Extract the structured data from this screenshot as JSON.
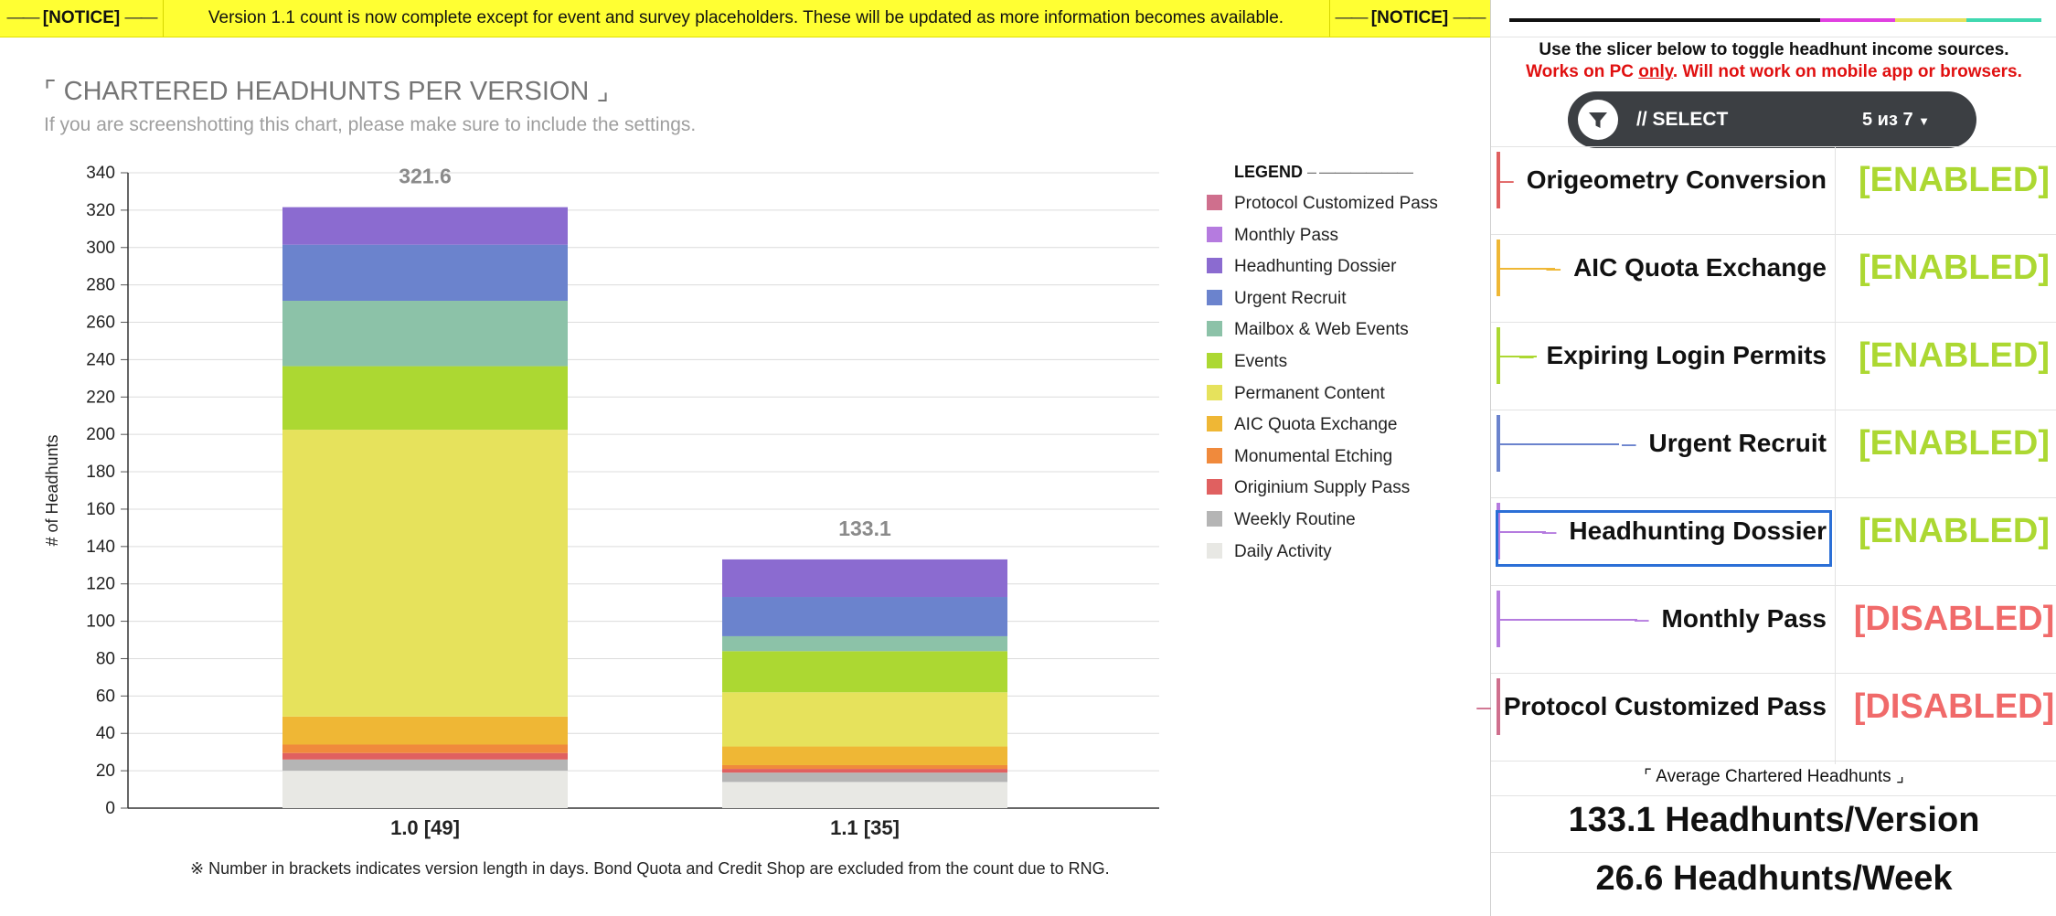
{
  "notice": {
    "tag_left": "[NOTICE]",
    "message": "Version 1.1 count is now complete except for event and survey placeholders. These will be updated as more information becomes available.",
    "tag_right": "[NOTICE]"
  },
  "chart": {
    "title": "CHARTERED HEADHUNTS PER VERSION",
    "title_open": "⌜",
    "title_close": "⌟",
    "subtitle": "If you are screenshotting this chart, please make sure to include the settings.",
    "footnote": "※ Number in brackets indicates version length in days. Bond Quota and Credit Shop are excluded from the count due to RNG.",
    "legend_title": "LEGEND",
    "legend_dash": "– ——————"
  },
  "chart_data": {
    "type": "bar",
    "stacked": true,
    "categories": [
      "1.0 [49]",
      "1.1 [35]"
    ],
    "totals": [
      "321.6",
      "133.1"
    ],
    "ylabel": "# of Headhunts",
    "xlabel": "",
    "ylim": [
      0,
      340
    ],
    "yticks": [
      0,
      20,
      40,
      60,
      80,
      100,
      120,
      140,
      160,
      180,
      200,
      220,
      240,
      260,
      280,
      300,
      320,
      340
    ],
    "grid": true,
    "legend_placement": "right",
    "series": [
      {
        "name": "Daily Activity",
        "color": "#e8e8e4",
        "values": [
          20,
          14
        ]
      },
      {
        "name": "Weekly Routine",
        "color": "#b5b5b5",
        "values": [
          6,
          5
        ]
      },
      {
        "name": "Originium Supply Pass",
        "color": "#e06060",
        "values": [
          3.5,
          2
        ]
      },
      {
        "name": "Monumental Etching",
        "color": "#f08a3c",
        "values": [
          4.5,
          2
        ]
      },
      {
        "name": "AIC Quota Exchange",
        "color": "#efb735",
        "values": [
          15,
          10
        ]
      },
      {
        "name": "Permanent Content",
        "color": "#e6e25c",
        "values": [
          153.5,
          29
        ]
      },
      {
        "name": "Events",
        "color": "#acd832",
        "values": [
          34,
          22
        ]
      },
      {
        "name": "Mailbox & Web Events",
        "color": "#8cc2a8",
        "values": [
          35,
          8
        ]
      },
      {
        "name": "Urgent Recruit",
        "color": "#6b83cd",
        "values": [
          30,
          21
        ]
      },
      {
        "name": "Headhunting Dossier",
        "color": "#8b6bd0",
        "values": [
          20.1,
          20.1
        ]
      },
      {
        "name": "Monthly Pass",
        "color": "#b57bdf",
        "values": [
          0,
          0
        ]
      },
      {
        "name": "Protocol Customized Pass",
        "color": "#cf6f8d",
        "values": [
          0,
          0
        ]
      }
    ]
  },
  "legend": [
    {
      "name": "Protocol Customized Pass",
      "color": "#cf6f8d"
    },
    {
      "name": "Monthly Pass",
      "color": "#b57bdf"
    },
    {
      "name": "Headhunting Dossier",
      "color": "#8b6bd0"
    },
    {
      "name": "Urgent Recruit",
      "color": "#6b83cd"
    },
    {
      "name": "Mailbox & Web Events",
      "color": "#8cc2a8"
    },
    {
      "name": "Events",
      "color": "#acd832"
    },
    {
      "name": "Permanent Content",
      "color": "#e6e25c"
    },
    {
      "name": "AIC Quota Exchange",
      "color": "#efb735"
    },
    {
      "name": "Monumental Etching",
      "color": "#f08a3c"
    },
    {
      "name": "Originium Supply Pass",
      "color": "#e06060"
    },
    {
      "name": "Weekly Routine",
      "color": "#b5b5b5"
    },
    {
      "name": "Daily Activity",
      "color": "#e8e8e4"
    }
  ],
  "panel": {
    "instruction": "Use the slicer below to toggle headhunt income sources.",
    "warning_pre": "Works on PC ",
    "warning_only": "only",
    "warning_post": ". Will not work on mobile app or browsers.",
    "slicer_label": "// SELECT",
    "slicer_count": "5 из 7",
    "strip_colors": [
      "#111111",
      "#e040e0",
      "#e6e25c",
      "#40d8b0"
    ],
    "sources": [
      {
        "name": "Origeometry Conversion",
        "status": "[ENABLED]",
        "color": "#e06060",
        "selected": false
      },
      {
        "name": "AIC Quota Exchange",
        "status": "[ENABLED]",
        "color": "#efb735",
        "selected": false
      },
      {
        "name": "Expiring Login Permits",
        "status": "[ENABLED]",
        "color": "#acd832",
        "selected": false
      },
      {
        "name": "Urgent Recruit",
        "status": "[ENABLED]",
        "color": "#6b83cd",
        "selected": false
      },
      {
        "name": "Headhunting Dossier",
        "status": "[ENABLED]",
        "color": "#b57bdf",
        "selected": true
      },
      {
        "name": "Monthly Pass",
        "status": "[DISABLED]",
        "color": "#b57bdf",
        "selected": false
      },
      {
        "name": "Protocol Customized Pass",
        "status": "[DISABLED]",
        "color": "#cf6f8d",
        "selected": false
      }
    ],
    "status_colors": {
      "enabled": "#acd832",
      "disabled": "#f06a6a"
    },
    "avg_title": "Average Chartered Headhunts",
    "avg_open": "⌜",
    "avg_close": "⌟",
    "avg_version": "133.1 Headhunts/Version",
    "avg_week": "26.6 Headhunts/Week"
  }
}
